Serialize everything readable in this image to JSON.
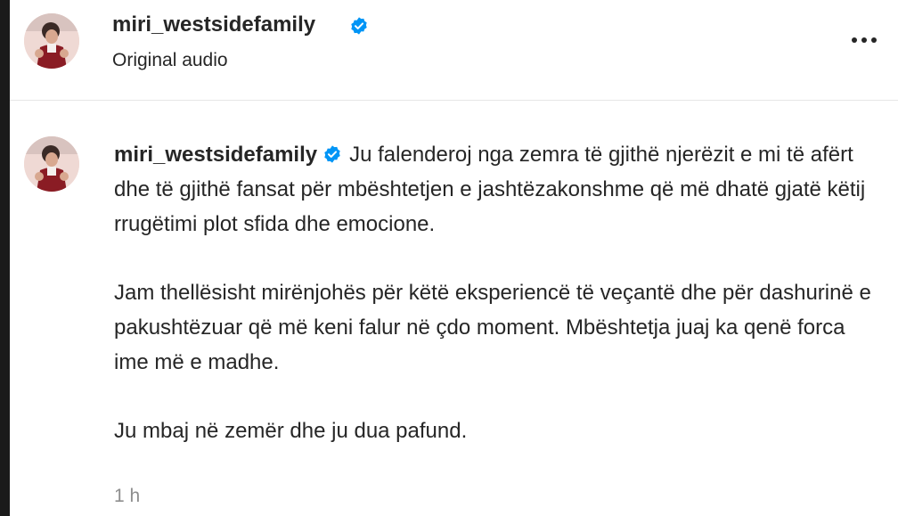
{
  "post": {
    "username": "miri_westsidefamily",
    "verified": true,
    "subtitle": "Original audio",
    "more_icon": "more-horizontal-icon"
  },
  "caption": {
    "username": "miri_westsidefamily",
    "paragraphs": [
      "Ju falenderoj nga zemra të gjithë njerëzit e mi të afërt dhe të gjithë fansat për mbështetjen e jashtëzakonshme që më dhatë gjatë këtij rrugëtimi plot sfida dhe emocione.",
      "Jam thellësisht mirënjohës për këtë eksperiencë të veçantë dhe për dashurinë e pakushtëzuar që më keni falur në çdo moment. Mbështetja juaj ka qenë forca ime më e madhe.",
      "Ju mbaj në zemër dhe ju dua pafund."
    ],
    "time": "1 h"
  },
  "colors": {
    "verified_badge": "#0095f6",
    "text": "#262626",
    "muted": "#8e8e8e"
  }
}
